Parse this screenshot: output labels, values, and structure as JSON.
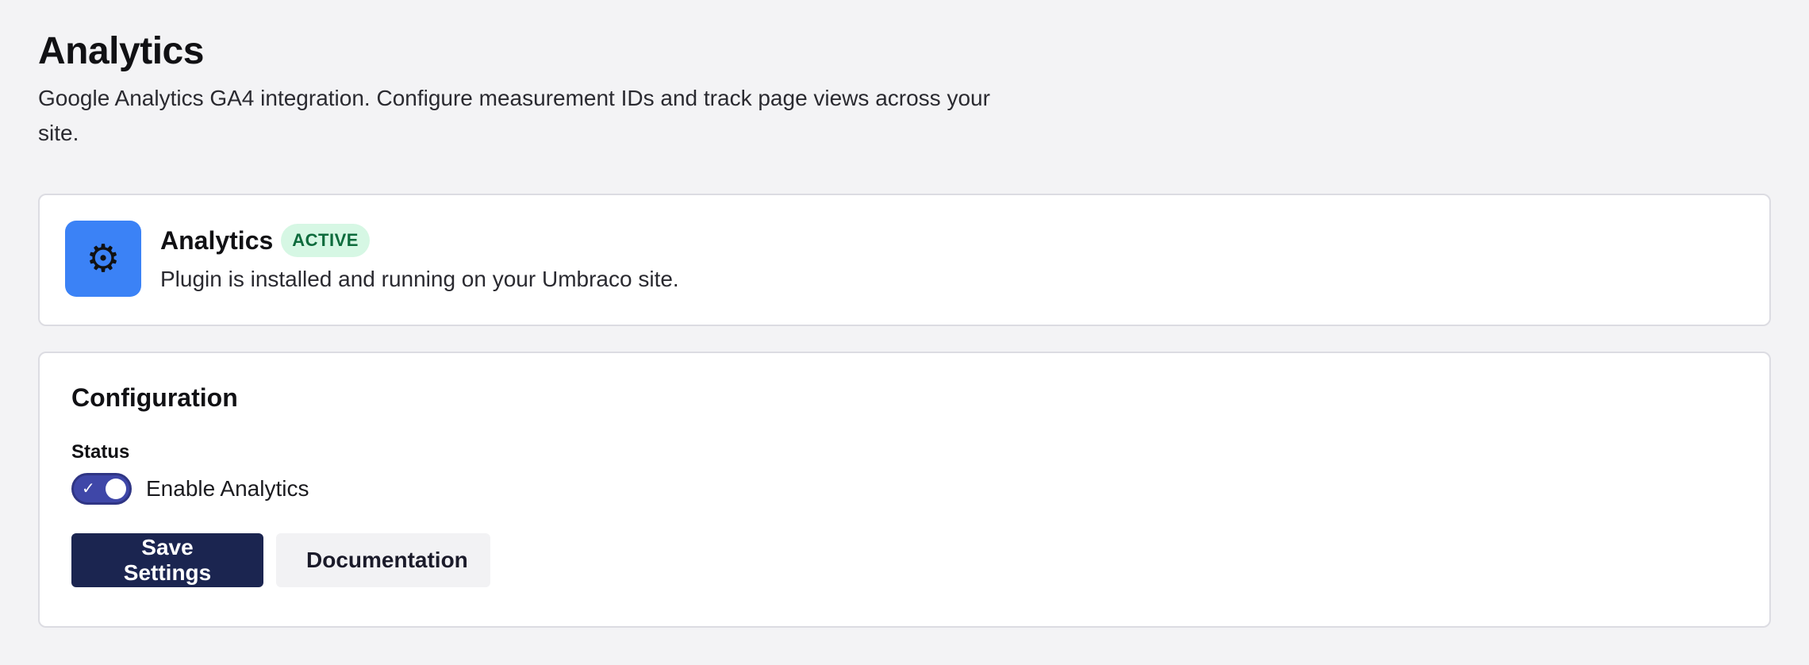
{
  "header": {
    "title": "Analytics",
    "description": "Google Analytics GA4 integration. Configure measurement IDs and track page views across your site."
  },
  "plugin_status": {
    "icon": "gear-icon",
    "icon_bg": "#3b82f6",
    "name": "Analytics",
    "badge": "ACTIVE",
    "badge_bg": "#d6f7e4",
    "badge_color": "#0d6b3c",
    "subtitle": "Plugin is installed and running on your Umbraco site."
  },
  "configuration": {
    "title": "Configuration",
    "status_label": "Status",
    "toggle": {
      "label": "Enable Analytics",
      "checked": true,
      "accent": "#3f47a8"
    },
    "buttons": {
      "save": "Save Settings",
      "documentation": "Documentation"
    }
  }
}
